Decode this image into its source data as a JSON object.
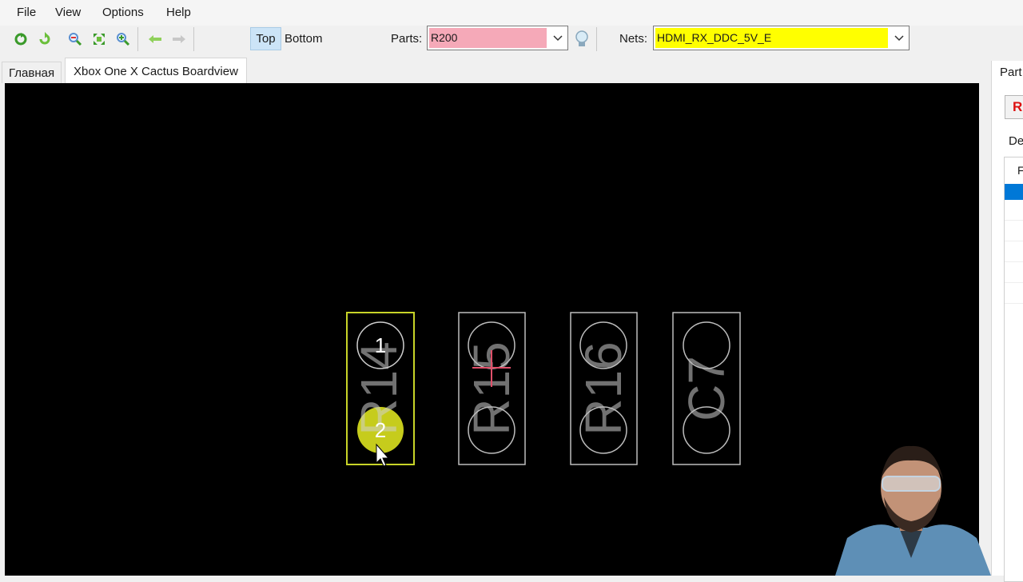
{
  "menu": [
    "File",
    "View",
    "Options",
    "Help"
  ],
  "toolbar": {
    "icons": [
      "reload-icon",
      "refresh-icon",
      "zoom-out-icon",
      "fit-view-icon",
      "zoom-in-icon",
      "back-arrow-icon",
      "forward-arrow-icon"
    ],
    "top_label": "Top",
    "bottom_label": "Bottom",
    "parts_label": "Parts:",
    "parts_value": "R200",
    "nets_label": "Nets:",
    "nets_value": "HDMI_RX_DDC_5V_E",
    "colors": {
      "parts_field": "#f5a9b8",
      "nets_field": "#ffff00",
      "active_side": "#cce4f7"
    }
  },
  "tabs": [
    {
      "label": "Главная",
      "active": false
    },
    {
      "label": "Xbox One X Cactus Boardview",
      "active": true
    }
  ],
  "board": {
    "background": "#000000",
    "components": [
      {
        "ref": "R14",
        "selected": true,
        "pins": [
          "1",
          "2"
        ],
        "highlighted_pin": "2"
      },
      {
        "ref": "R15",
        "selected": false,
        "pins": [
          "",
          ""
        ]
      },
      {
        "ref": "R16",
        "selected": false,
        "pins": [
          "",
          ""
        ]
      },
      {
        "ref": "C7",
        "selected": false,
        "pins": [
          "",
          ""
        ]
      }
    ],
    "colors": {
      "selected_outline": "#c8d428",
      "outline": "#bdbdbd",
      "highlight_pin": "#c6cc1c",
      "marker": "#e0506a"
    }
  },
  "right_panel": {
    "tab_label": "Part",
    "button_label": "R",
    "field_label": "De",
    "grid_header": "F"
  }
}
